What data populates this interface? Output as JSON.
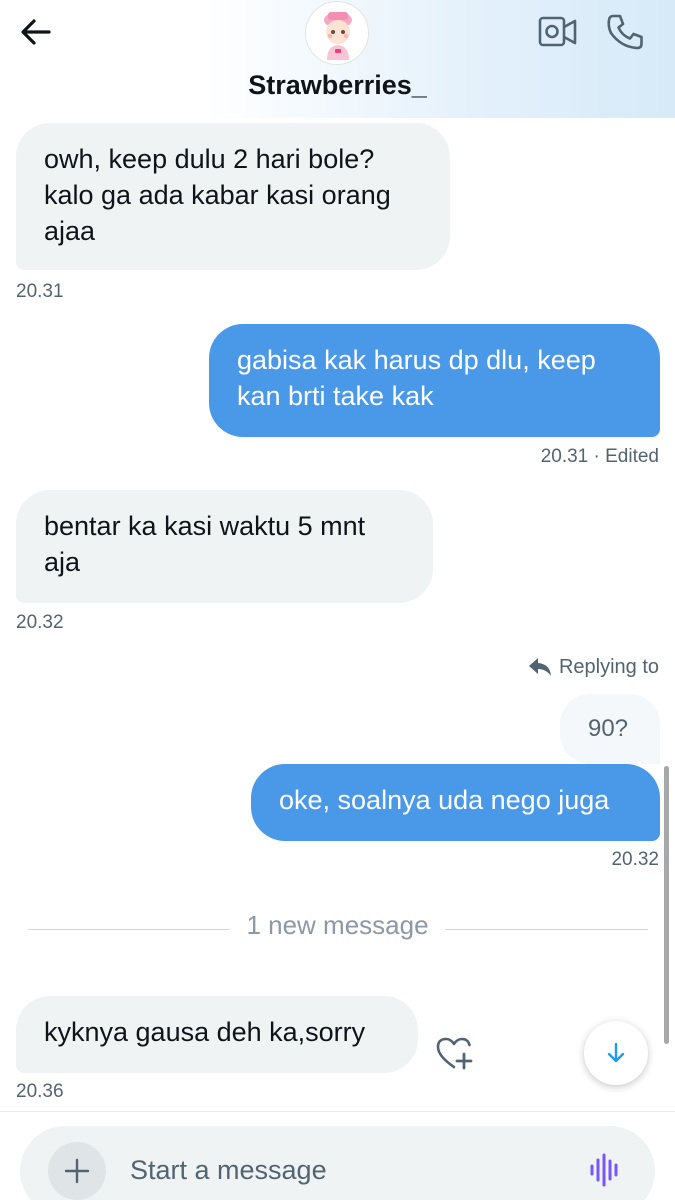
{
  "header": {
    "title": "Strawberries_",
    "icons": [
      "back-arrow-icon",
      "video-call-icon",
      "phone-icon"
    ]
  },
  "messages": [
    {
      "side": "in",
      "lines": [
        "owh, keep dulu 2 hari bole?",
        "kalo ga ada kabar kasi orang",
        "ajaa"
      ],
      "time": "20.31"
    },
    {
      "side": "out",
      "lines": [
        "gabisa kak harus dp dlu, keep",
        "kan brti take kak"
      ],
      "time": "20.31 · Edited"
    },
    {
      "side": "in",
      "lines": [
        "bentar ka kasi waktu 5 mnt",
        "aja"
      ],
      "time": "20.32"
    },
    {
      "side": "out",
      "reply_label": "Replying to",
      "quoted_text": "90?",
      "lines": [
        "oke, soalnya uda nego juga"
      ],
      "time": "20.32"
    },
    {
      "side": "in",
      "lines": [
        "kyknya gausa deh ka,sorry"
      ],
      "time": "20.36"
    }
  ],
  "new_message_divider": "1 new message",
  "composer": {
    "placeholder": "Start a message"
  },
  "colors": {
    "outgoing_bubble": "#4a99e9",
    "incoming_bubble": "#eff3f4",
    "accent": "#1d9bf0",
    "voice": "#7856ff"
  }
}
